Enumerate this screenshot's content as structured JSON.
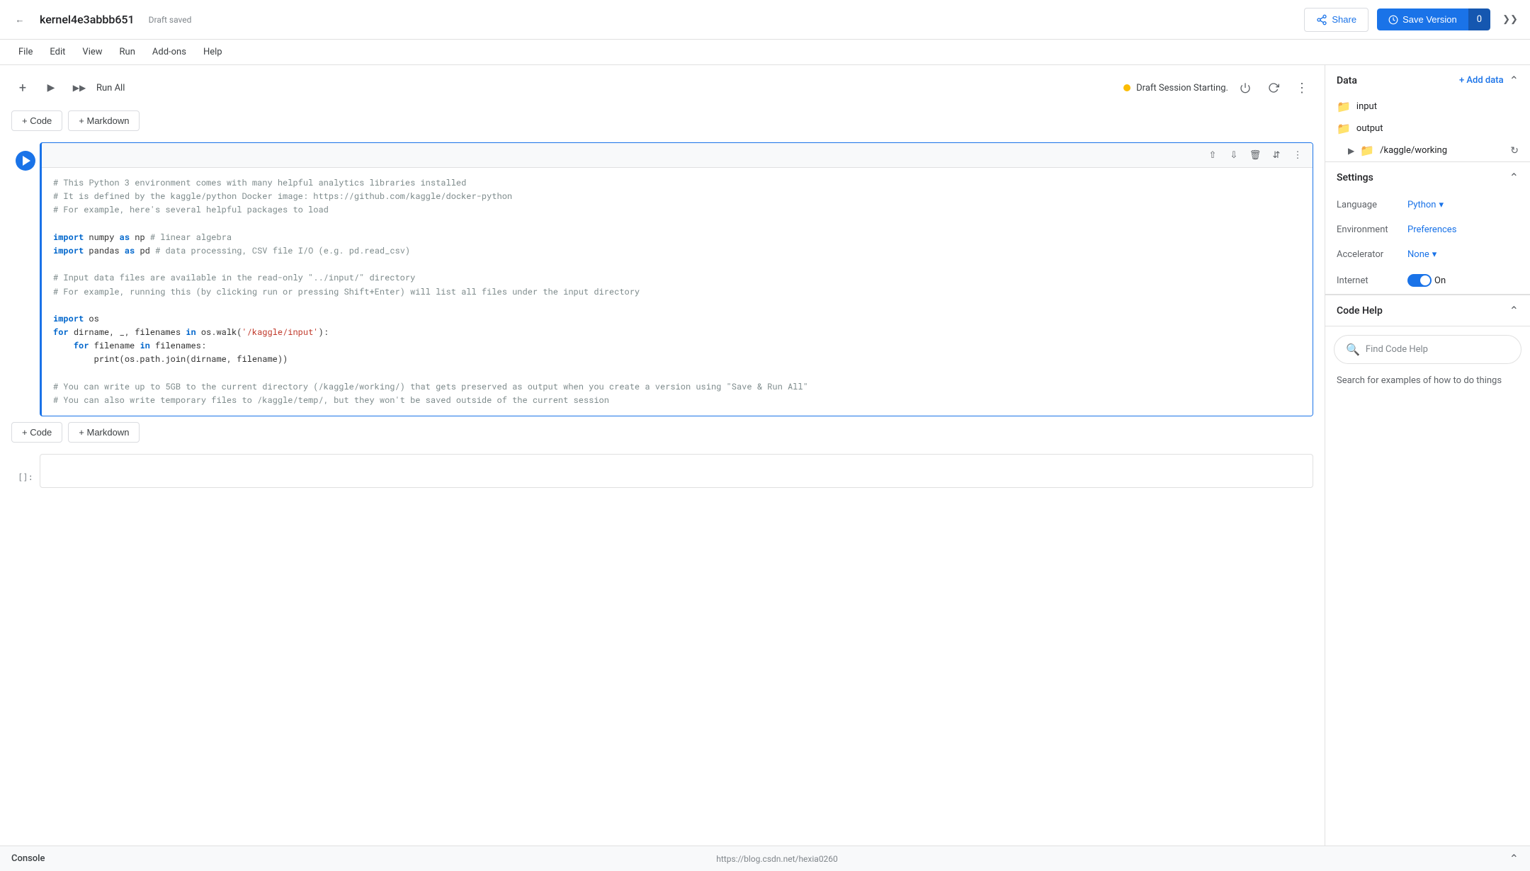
{
  "header": {
    "kernel_title": "kernel4e3abbb651",
    "draft_status": "Draft saved",
    "share_label": "Share",
    "save_version_label": "Save Version",
    "version_count": "0"
  },
  "menu": {
    "items": [
      "File",
      "Edit",
      "View",
      "Run",
      "Add-ons",
      "Help"
    ]
  },
  "toolbar": {
    "run_all_label": "Run All",
    "session_status": "Draft Session Starting.",
    "add_code_label": "+ Code",
    "add_markdown_label": "+ Markdown"
  },
  "cell": {
    "code_lines": [
      "# This Python 3 environment comes with many helpful analytics libraries installed",
      "# It is defined by the kaggle/python Docker image: https://github.com/kaggle/docker-python",
      "# For example, here's several helpful packages to load",
      "",
      "import numpy as np # linear algebra",
      "import pandas as pd # data processing, CSV file I/O (e.g. pd.read_csv)",
      "",
      "# Input data files are available in the read-only \"../input/\" directory",
      "# For example, running this (by clicking run or pressing Shift+Enter) will list all files under the input directory",
      "",
      "import os",
      "for dirname, _, filenames in os.walk('/kaggle/input'):",
      "    for filename in filenames:",
      "        print(os.path.join(dirname, filename))",
      "",
      "# You can write up to 5GB to the current directory (/kaggle/working/) that gets preserved as output when you create a version using \"Save & Run All\"",
      "# You can also write temporary files to /kaggle/temp/, but they won't be saved outside of the current session"
    ],
    "empty_label": "[]:"
  },
  "sidebar": {
    "data_title": "Data",
    "add_data_label": "+ Add data",
    "data_items": [
      {
        "name": "input",
        "type": "folder"
      },
      {
        "name": "output",
        "type": "folder"
      },
      {
        "name": "/kaggle/working",
        "type": "folder",
        "expandable": true
      }
    ],
    "settings_title": "Settings",
    "language_label": "Language",
    "language_value": "Python",
    "environment_label": "Environment",
    "environment_value": "Preferences",
    "accelerator_label": "Accelerator",
    "accelerator_value": "None",
    "internet_label": "Internet",
    "internet_value": "On",
    "code_help_title": "Code Help",
    "code_help_search_placeholder": "Find Code Help",
    "code_help_desc": "Search for examples of how to do things"
  },
  "console": {
    "label": "Console",
    "url": "https://blog.csdn.net/hexia0260"
  }
}
